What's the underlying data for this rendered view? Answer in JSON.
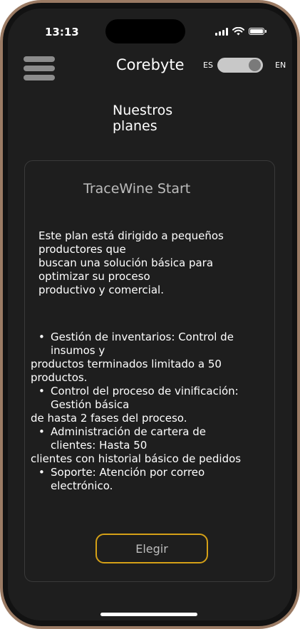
{
  "status_bar": {
    "time": "13:13"
  },
  "header": {
    "app_title": "Corebyte",
    "lang_left": "ES",
    "lang_right": "EN",
    "lang_toggle_selected": "EN"
  },
  "section_title_lines": [
    "Nuestros",
    "planes"
  ],
  "plan": {
    "name": "TraceWine Start",
    "description_lines": [
      "Este plan está dirigido a pequeños",
      "productores que",
      "buscan una solución básica para",
      "optimizar su proceso",
      "productivo y comercial."
    ],
    "features": [
      {
        "lines": [
          "Gestión de inventarios: Control de",
          "insumos y"
        ],
        "continuation": [
          "productos terminados limitado a 50",
          "productos."
        ]
      },
      {
        "lines": [
          "Control del proceso de vinificación:",
          "Gestión básica"
        ],
        "continuation": [
          "de hasta 2 fases del proceso."
        ]
      },
      {
        "lines": [
          "Administración de cartera de",
          "clientes: Hasta 50"
        ],
        "continuation": [
          "clientes con historial básico de pedidos"
        ]
      },
      {
        "lines": [
          "Soporte: Atención por correo",
          "electrónico."
        ],
        "continuation": []
      }
    ],
    "bullet": "•",
    "choose_label": "Elegir"
  },
  "colors": {
    "background": "#1e1e1e",
    "accent_border": "#d4a017",
    "frame": "#9b7b64"
  },
  "icons": {
    "menu": "hamburger-menu-icon",
    "signal": "cellular-signal-icon",
    "wifi": "wifi-icon",
    "battery": "battery-icon"
  }
}
